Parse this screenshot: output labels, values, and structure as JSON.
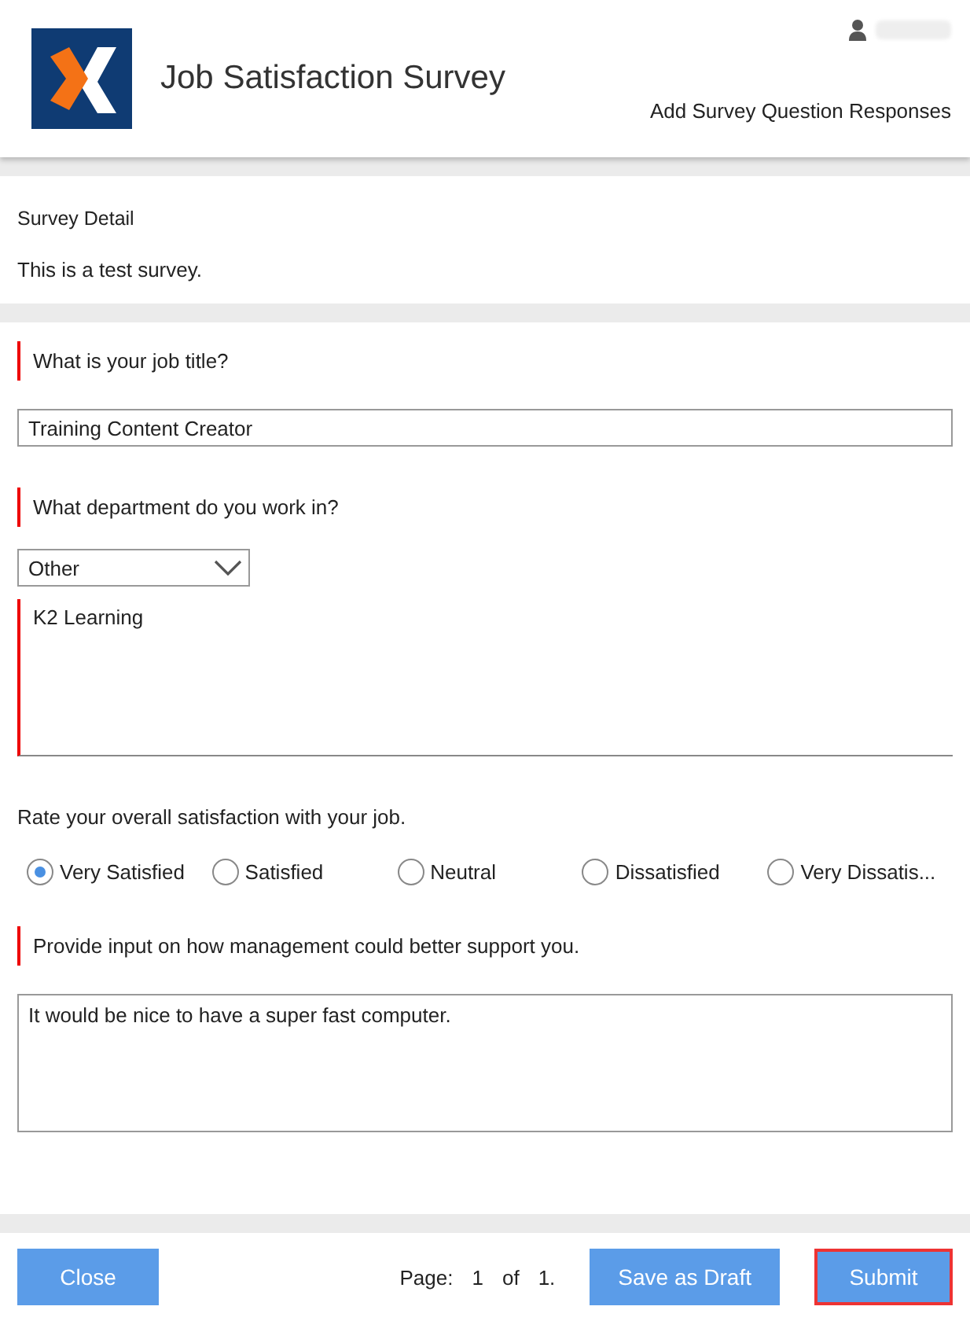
{
  "header": {
    "title": "Job Satisfaction Survey",
    "subtitle": "Add Survey Question Responses"
  },
  "detail": {
    "heading": "Survey Detail",
    "text": "This is a test survey."
  },
  "questions": [
    {
      "kind": "text",
      "required": true,
      "label": "What is your job title?",
      "value": "Training Content Creator"
    },
    {
      "kind": "choice",
      "required": true,
      "label": "What department do you work in?",
      "value": "Other",
      "other_value": "K2 Learning"
    },
    {
      "kind": "rating",
      "required": false,
      "label": "Rate your overall satisfaction with your job.",
      "options": [
        {
          "label": "Very Satisfied",
          "selected": true
        },
        {
          "label": "Satisfied",
          "selected": false
        },
        {
          "label": "Neutral",
          "selected": false
        },
        {
          "label": "Dissatisfied",
          "selected": false
        },
        {
          "label": "Very Dissatis...",
          "selected": false
        }
      ]
    },
    {
      "kind": "longtext",
      "required": true,
      "label": "Provide input on how management could better support you.",
      "value": "It would be nice to have a super fast computer."
    }
  ],
  "footer": {
    "close": "Close",
    "page_label": "Page:",
    "page": "1",
    "of": "of",
    "pages": "1.",
    "buttons": [
      {
        "label": "Save as Draft",
        "focused": false
      },
      {
        "label": "Submit",
        "focused": true
      }
    ]
  }
}
